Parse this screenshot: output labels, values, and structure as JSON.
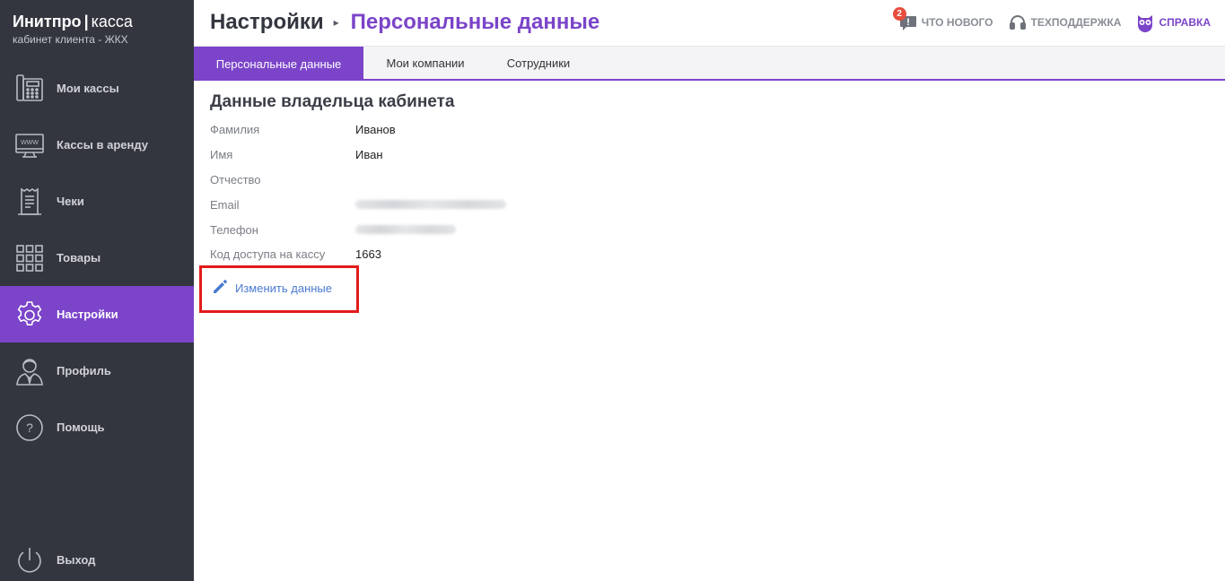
{
  "brand": {
    "name_bold": "Инитпро",
    "separator": "|",
    "name_light": "касса",
    "subtitle": "кабинет клиента - ЖКХ"
  },
  "sidebar": {
    "items": [
      {
        "label": "Мои кассы",
        "icon": "cash-register-icon"
      },
      {
        "label": "Кассы в аренду",
        "icon": "monitor-www-icon"
      },
      {
        "label": "Чеки",
        "icon": "receipt-icon"
      },
      {
        "label": "Товары",
        "icon": "grid-icon"
      },
      {
        "label": "Настройки",
        "icon": "gear-icon",
        "active": true
      },
      {
        "label": "Профиль",
        "icon": "user-icon"
      },
      {
        "label": "Помощь",
        "icon": "question-icon"
      }
    ],
    "logout": {
      "label": "Выход",
      "icon": "power-icon"
    }
  },
  "header": {
    "breadcrumb_root": "Настройки",
    "breadcrumb_sep": "▸",
    "breadcrumb_current": "Персональные данные",
    "links": {
      "news": {
        "label": "ЧТО НОВОГО",
        "badge": "2",
        "icon": "chat-alert-icon"
      },
      "support": {
        "label": "ТЕХПОДДЕРЖКА",
        "icon": "headset-icon"
      },
      "help": {
        "label": "СПРАВКА",
        "icon": "owl-icon"
      }
    }
  },
  "tabs": [
    {
      "label": "Персональные данные",
      "active": true
    },
    {
      "label": "Мои компании"
    },
    {
      "label": "Сотрудники"
    }
  ],
  "owner": {
    "title": "Данные владельца кабинета",
    "fields": {
      "last_name": {
        "label": "Фамилия",
        "value": "Иванов"
      },
      "first_name": {
        "label": "Имя",
        "value": "Иван"
      },
      "patronymic": {
        "label": "Отчество",
        "value": ""
      },
      "email": {
        "label": "Email"
      },
      "phone": {
        "label": "Телефон"
      },
      "access_code": {
        "label": "Код доступа на кассу",
        "value": "1663"
      }
    },
    "edit_label": "Изменить данные"
  },
  "colors": {
    "accent": "#7b44c9",
    "sidebar_bg": "#33363f",
    "highlight": "#e21b1b",
    "link": "#4a7bd0",
    "badge": "#e74c3c"
  }
}
